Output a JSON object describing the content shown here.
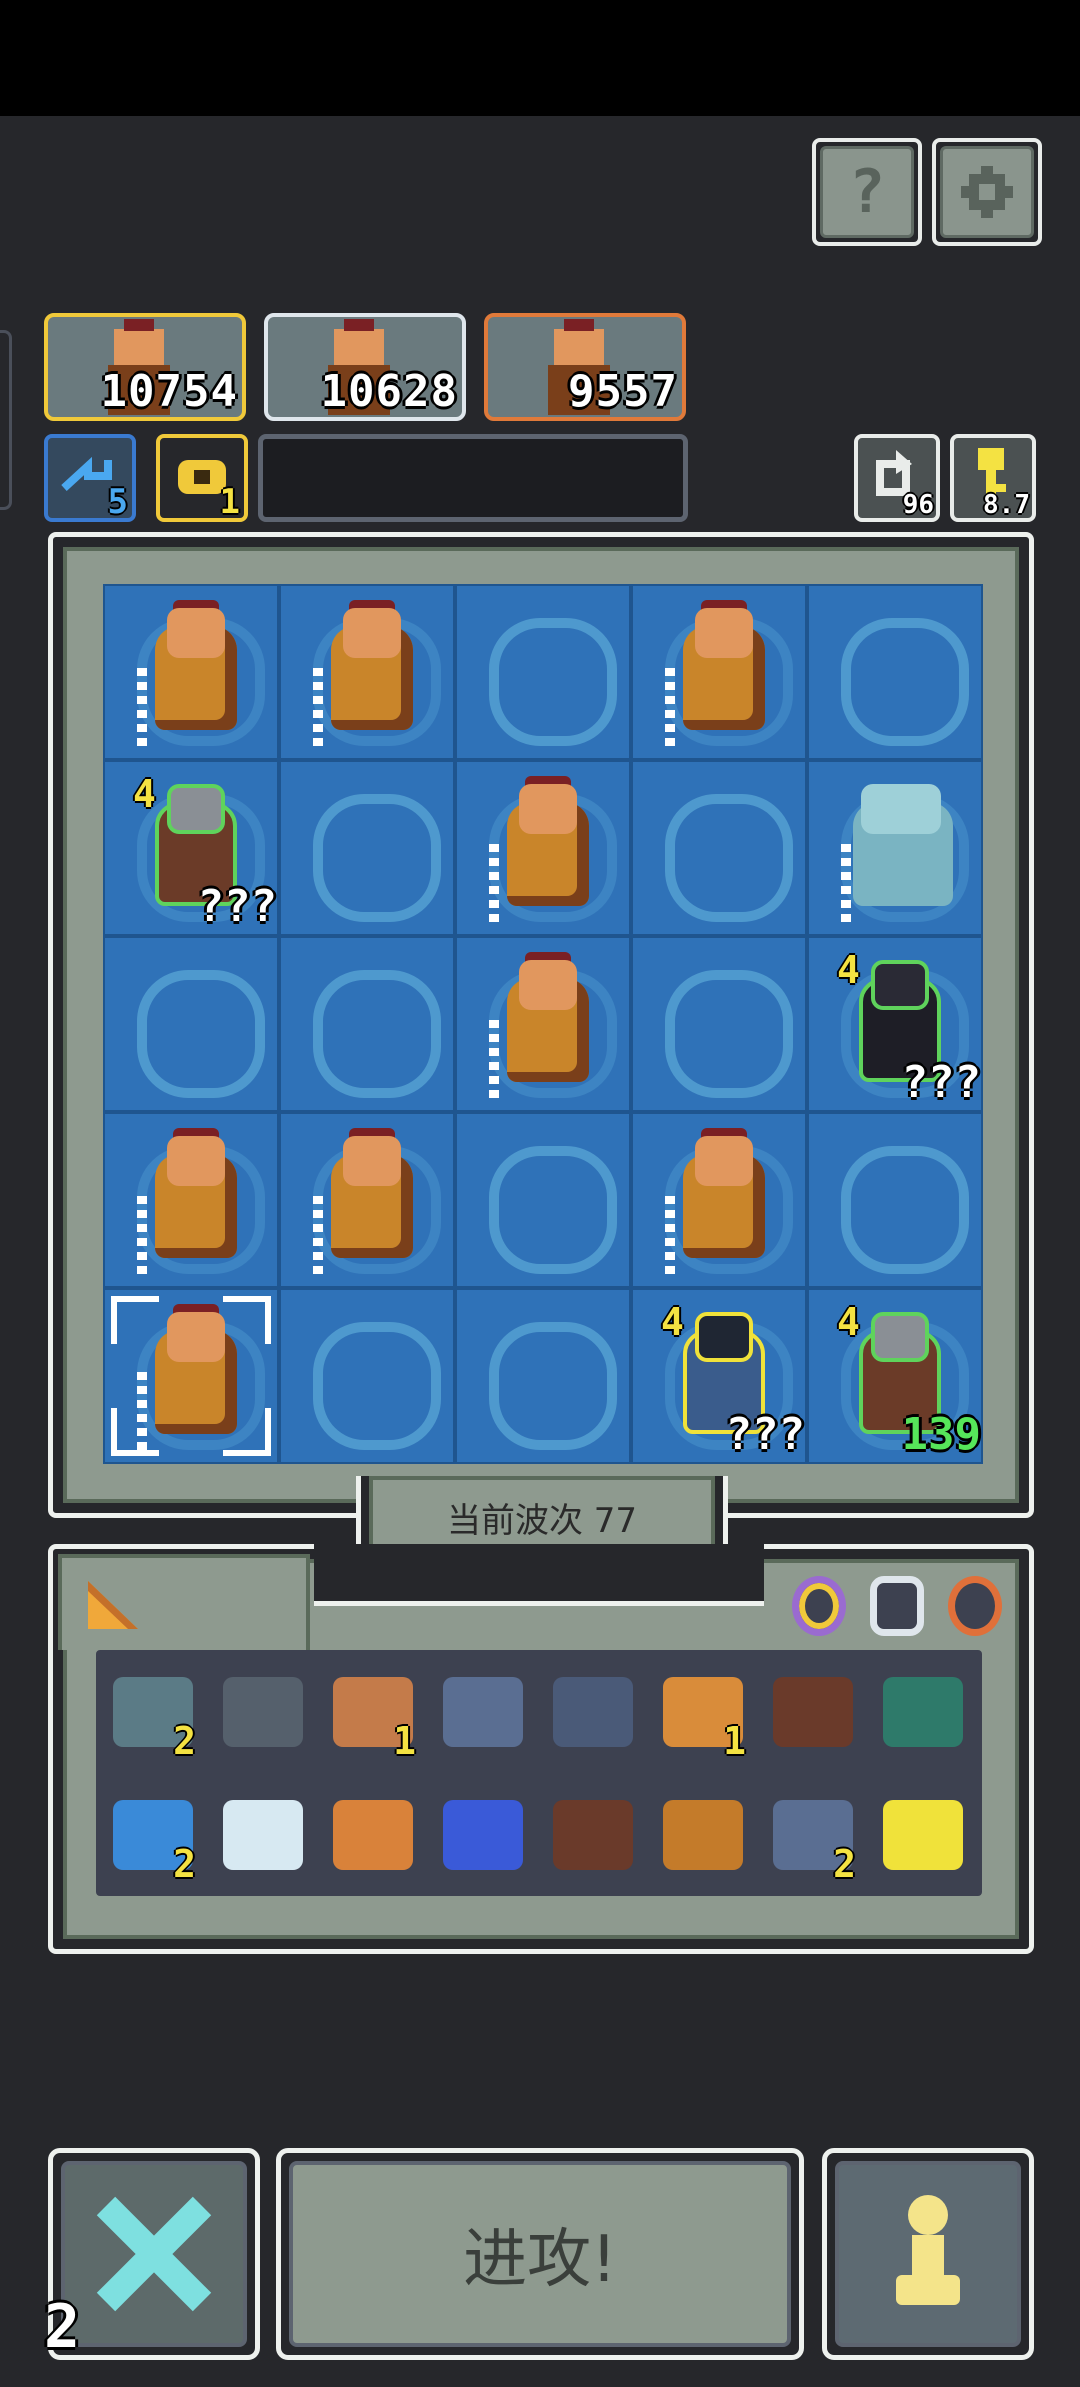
{
  "top_buttons": {
    "help_label": "?",
    "settings_icon": "gear-icon"
  },
  "heroes": [
    {
      "score": "10754",
      "border": "#f0c93a"
    },
    {
      "score": "10628",
      "border": "#dfe6ec"
    },
    {
      "score": "9557",
      "border": "#e07a3a"
    }
  ],
  "resources": {
    "swap": {
      "count": "5",
      "icon": "swap-arrows-icon"
    },
    "coin": {
      "count": "1",
      "icon": "coin-icon"
    }
  },
  "counters": {
    "refresh": {
      "value": "96",
      "icon": "refresh-icon"
    },
    "key": {
      "value": "8.7",
      "icon": "key-icon"
    }
  },
  "board": {
    "rows": [
      [
        {
          "type": "warrior"
        },
        {
          "type": "warrior"
        },
        {
          "type": "empty"
        },
        {
          "type": "warrior"
        },
        {
          "type": "empty"
        }
      ],
      [
        {
          "type": "knight",
          "level": "4",
          "tag": "???"
        },
        {
          "type": "empty"
        },
        {
          "type": "warrior"
        },
        {
          "type": "empty"
        },
        {
          "type": "ogre"
        }
      ],
      [
        {
          "type": "empty"
        },
        {
          "type": "empty"
        },
        {
          "type": "warrior"
        },
        {
          "type": "empty"
        },
        {
          "type": "witch",
          "level": "4",
          "tag": "???"
        }
      ],
      [
        {
          "type": "warrior"
        },
        {
          "type": "warrior"
        },
        {
          "type": "empty"
        },
        {
          "type": "warrior"
        },
        {
          "type": "empty"
        }
      ],
      [
        {
          "type": "warrior",
          "selected": true
        },
        {
          "type": "empty"
        },
        {
          "type": "empty"
        },
        {
          "type": "mage",
          "level": "4",
          "tag": "???"
        },
        {
          "type": "knight",
          "level": "4",
          "tag": "139",
          "hp": true
        }
      ]
    ]
  },
  "wave": {
    "label": "当前波次 77"
  },
  "inventory": {
    "tab_icon": "cheese-wedge-icon",
    "filters": [
      {
        "icon": "amulet-icon",
        "color": "#9a6bd0"
      },
      {
        "icon": "armor-icon",
        "color": "#dfe6ec"
      },
      {
        "icon": "ring-icon",
        "color": "#e0703a"
      }
    ],
    "items": [
      {
        "icon": "heart-shield-icon",
        "color": "#5b7b86",
        "count": "2"
      },
      {
        "icon": "shield-icon",
        "color": "#55606c"
      },
      {
        "icon": "scroll-icon",
        "color": "#c47b4a",
        "count": "1"
      },
      {
        "icon": "portrait-icon",
        "color": "#5a6e92"
      },
      {
        "icon": "gauntlet-icon",
        "color": "#4a5a78"
      },
      {
        "icon": "bell-icon",
        "color": "#d98c3a",
        "count": "1"
      },
      {
        "icon": "book-icon",
        "color": "#6a3a2a"
      },
      {
        "icon": "gate-icon",
        "color": "#2e7a6a"
      },
      {
        "icon": "crystal-ball-icon",
        "color": "#3a8ad8",
        "count": "2"
      },
      {
        "icon": "ice-crystal-icon",
        "color": "#d7e9f2"
      },
      {
        "icon": "wooden-stick-icon",
        "color": "#d9823a"
      },
      {
        "icon": "potion-icon",
        "color": "#3a5ad8"
      },
      {
        "icon": "spiked-log-icon",
        "color": "#6a3a2a"
      },
      {
        "icon": "frame-icon",
        "color": "#c47b2a"
      },
      {
        "icon": "stairs-icon",
        "color": "#5a6e92",
        "count": "2"
      },
      {
        "icon": "battle-axe-icon",
        "color": "#f0e23a"
      }
    ]
  },
  "actions": {
    "skip": {
      "icon": "cross-swords-icon",
      "count": "2"
    },
    "attack_label": "进攻!",
    "pawn": {
      "icon": "pawn-icon"
    }
  },
  "colors": {
    "background": "#26272b",
    "panel": "#8e9a8f",
    "tile": "#2f72b8",
    "gold": "#f4e242",
    "hp": "#56e65a"
  }
}
